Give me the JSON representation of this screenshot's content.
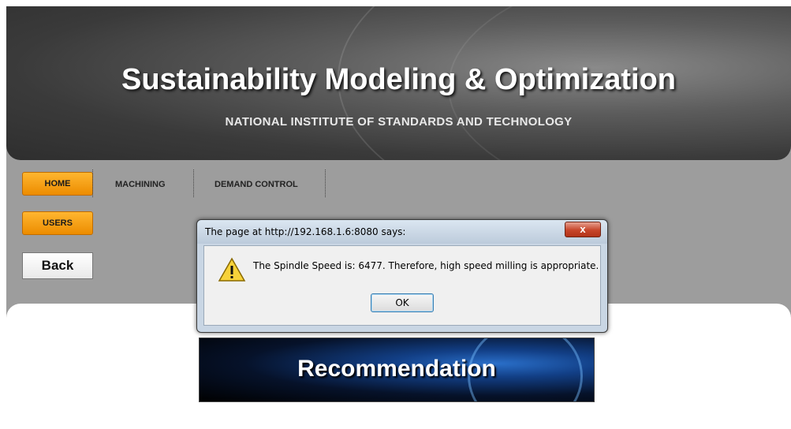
{
  "header": {
    "title": "Sustainability Modeling & Optimization",
    "subtitle": "NATIONAL INSTITUTE OF STANDARDS AND TECHNOLOGY"
  },
  "nav": {
    "home": "HOME",
    "users": "USERS",
    "machining": "MACHINING",
    "demand_control": "DEMAND CONTROL",
    "back": "Back"
  },
  "banner": {
    "text": "Recommendation"
  },
  "dialog": {
    "title": "The page at http://192.168.1.6:8080 says:",
    "close_label": "x",
    "message": "The Spindle Speed is: 6477. Therefore, high speed milling is appropriate.",
    "ok_label": "OK",
    "icon": "warning-icon"
  },
  "colors": {
    "accent_orange": "#f5a51a",
    "header_dark": "#3a3a3a",
    "page_gray": "#9d9d9d"
  }
}
